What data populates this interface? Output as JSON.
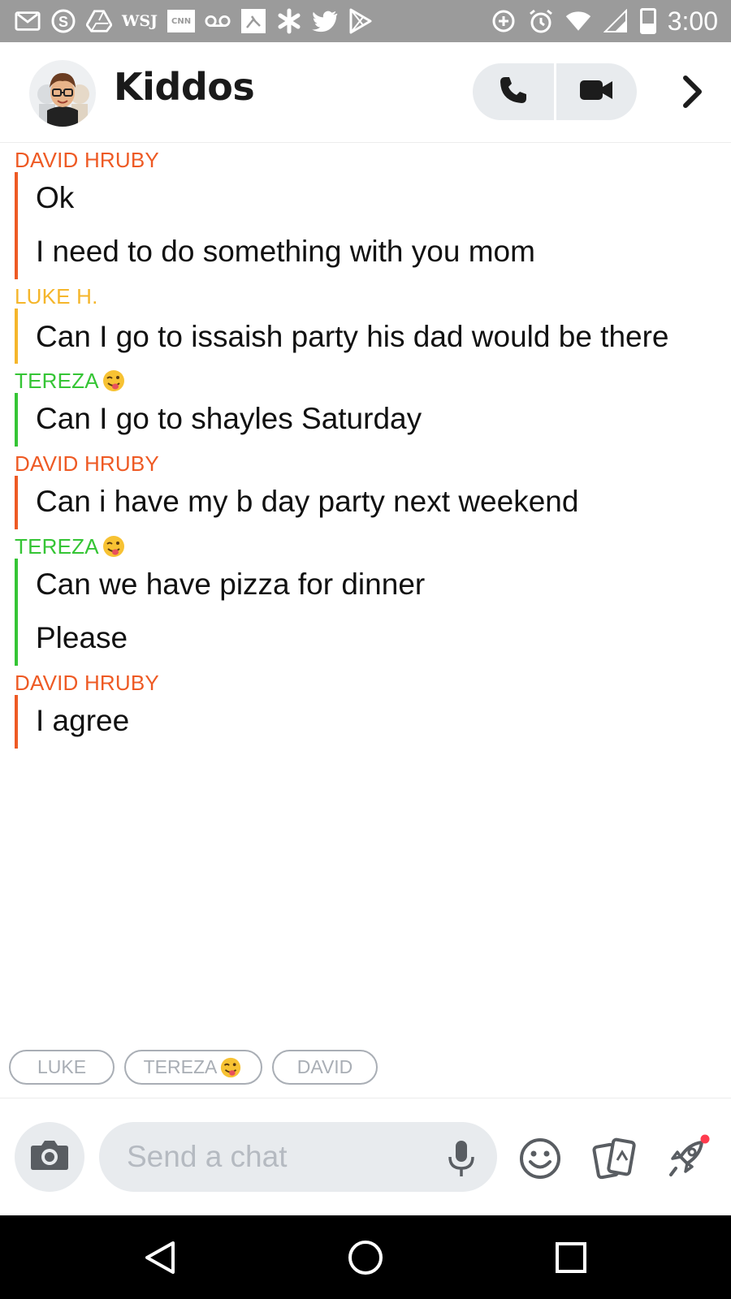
{
  "status_bar": {
    "time": "3:00",
    "wsj_label": "WSJ",
    "cnn_label": "CNN",
    "icons": [
      "gmail-icon",
      "skype-icon",
      "drive-icon",
      "wsj-icon",
      "cnn-icon",
      "voicemail-icon",
      "app-icon",
      "asterisk-icon",
      "twitter-icon",
      "play-store-icon",
      "data-saver-icon",
      "alarm-icon",
      "wifi-icon",
      "signal-icon",
      "battery-icon"
    ]
  },
  "header": {
    "title": "Kiddos",
    "icons": {
      "call": "phone-icon",
      "video": "video-camera-icon",
      "more": "chevron-right-icon"
    }
  },
  "messages": [
    {
      "sender": "DAVID HRUBY",
      "sender_emoji": "",
      "color": "#ee5a24",
      "lines": [
        "Ok",
        "I need to do something with you mom"
      ]
    },
    {
      "sender": "LUKE H.",
      "sender_emoji": "",
      "color": "#f5b62b",
      "lines": [
        "Can I go to issaish party his dad would be there"
      ]
    },
    {
      "sender": "TEREZA",
      "sender_emoji": "winking-tongue-emoji",
      "color": "#35c535",
      "lines": [
        "Can I go to shayles Saturday"
      ]
    },
    {
      "sender": "DAVID HRUBY",
      "sender_emoji": "",
      "color": "#ee5a24",
      "lines": [
        "Can i have my b day party next weekend"
      ]
    },
    {
      "sender": "TEREZA",
      "sender_emoji": "winking-tongue-emoji",
      "color": "#35c535",
      "lines": [
        "Can we have pizza for dinner",
        "Please"
      ]
    },
    {
      "sender": "DAVID HRUBY",
      "sender_emoji": "",
      "color": "#ee5a24",
      "lines": [
        "I agree"
      ]
    }
  ],
  "mention_chips": [
    {
      "label": "LUKE",
      "emoji": ""
    },
    {
      "label": "TEREZA",
      "emoji": "winking-tongue-emoji"
    },
    {
      "label": "DAVID",
      "emoji": ""
    }
  ],
  "input_bar": {
    "placeholder": "Send a chat",
    "icons": [
      "camera-icon",
      "microphone-icon",
      "smiley-icon",
      "cards-icon",
      "rocket-icon"
    ]
  },
  "nav_bar": {
    "icons": [
      "back-triangle-icon",
      "home-circle-icon",
      "recents-square-icon"
    ]
  },
  "colors": {
    "david": "#ee5a24",
    "luke": "#f5b62b",
    "tereza": "#35c535",
    "status_bar": "#9b9b9b",
    "pill_bg": "#e8ebee",
    "notification_dot": "#ff3b4e"
  }
}
